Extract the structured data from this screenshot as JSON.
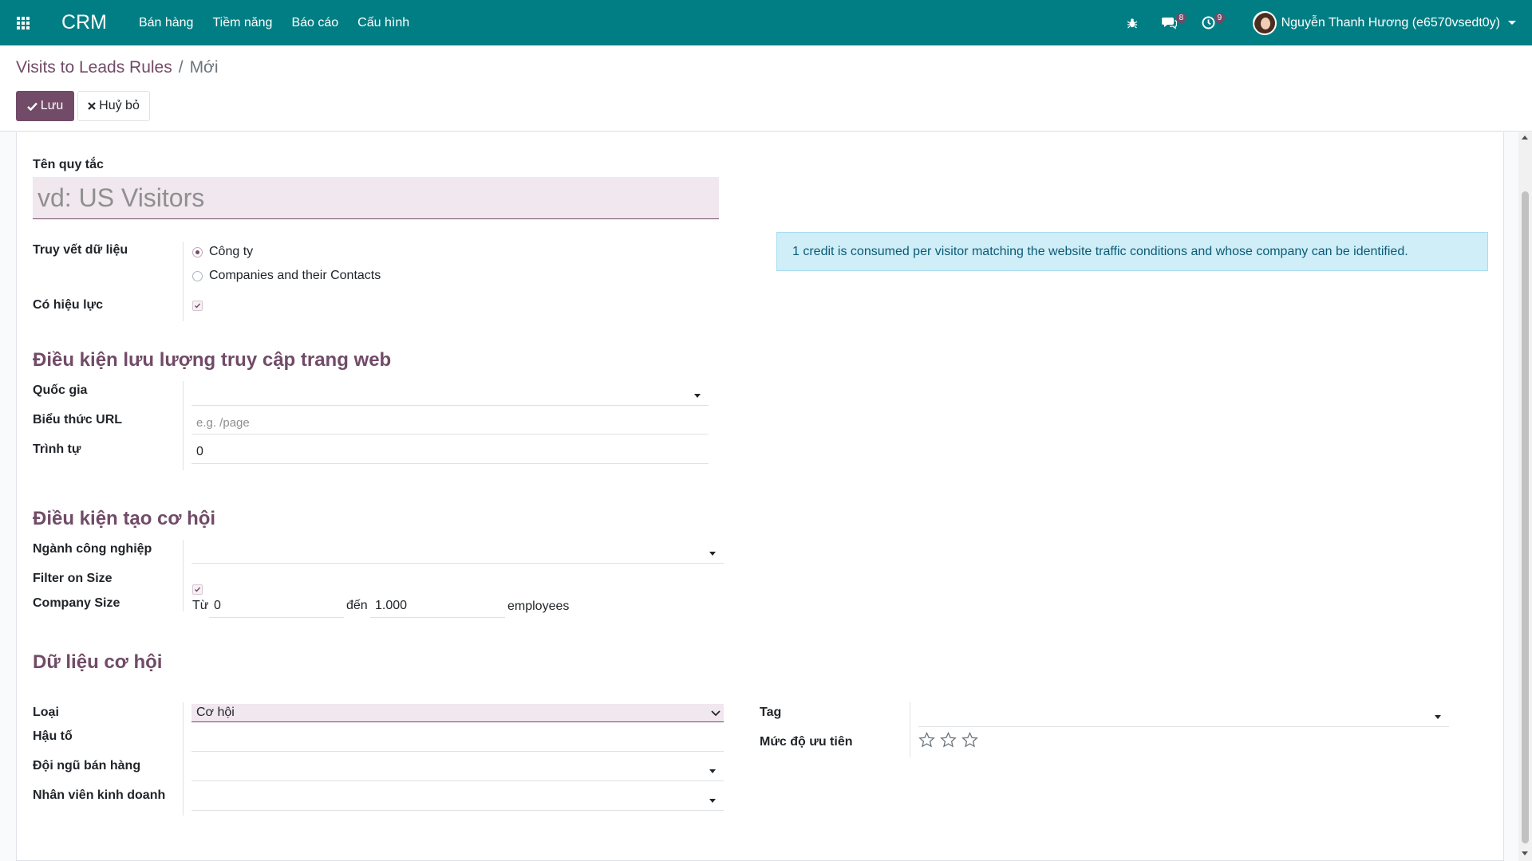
{
  "navbar": {
    "brand": "CRM",
    "menu": [
      "Bán hàng",
      "Tiềm năng",
      "Báo cáo",
      "Cấu hình"
    ],
    "messages_count": "8",
    "activities_count": "9",
    "user_name": "Nguyễn Thanh Hương (e6570vsedt0y)"
  },
  "breadcrumb": {
    "parent": "Visits to Leads Rules",
    "separator": "/",
    "current": "Mới"
  },
  "actions": {
    "save": "Lưu",
    "cancel": "Huỷ bỏ"
  },
  "form": {
    "name_label": "Tên quy tắc",
    "name_placeholder": "vd: US Visitors",
    "tracking_label": "Truy vết dữ liệu",
    "tracking_options": [
      {
        "label": "Công ty",
        "checked": true
      },
      {
        "label": "Companies and their Contacts",
        "checked": false
      }
    ],
    "active_label": "Có hiệu lực",
    "active_checked": true,
    "alert_text": "1 credit is consumed per visitor matching the website traffic conditions and whose company can be identified.",
    "traffic_section": "Điều kiện lưu lượng truy cập trang web",
    "country_label": "Quốc gia",
    "country_value": "",
    "url_label": "Biểu thức URL",
    "url_placeholder": "e.g. /page",
    "sequence_label": "Trình tự",
    "sequence_value": "0",
    "opportunity_section": "Điều kiện tạo cơ hội",
    "industry_label": "Ngành công nghiệp",
    "industry_value": "",
    "filter_size_label": "Filter on Size",
    "filter_size_checked": true,
    "company_size_label": "Company Size",
    "size_from_label": "Từ",
    "size_from_value": "0",
    "size_to_label": "đến",
    "size_to_value": "1.000",
    "size_unit": "employees",
    "lead_data_section": "Dữ liệu cơ hội",
    "type_label": "Loại",
    "type_value": "Cơ hội",
    "suffix_label": "Hậu tố",
    "suffix_value": "",
    "team_label": "Đội ngũ bán hàng",
    "team_value": "",
    "salesperson_label": "Nhân viên kinh doanh",
    "salesperson_value": "",
    "tag_label": "Tag",
    "tag_value": "",
    "priority_label": "Mức độ ưu tiên",
    "priority_stars": 3,
    "priority_value": 0
  },
  "colors": {
    "navbar": "#017e84",
    "primary": "#714b67",
    "alert_bg": "#cfeef8",
    "input_highlight": "#f1e7ef"
  },
  "icons": [
    "apps-grid-icon",
    "bug-icon",
    "chat-icon",
    "clock-icon",
    "check-icon",
    "close-icon",
    "star-icon",
    "chevron-down-icon"
  ]
}
